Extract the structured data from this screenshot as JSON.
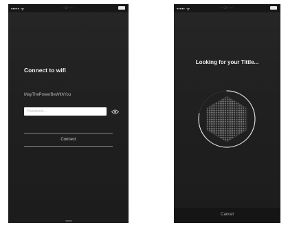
{
  "status_bar": {
    "carrier": "••••• ᯤ",
    "time": "··:·· ··"
  },
  "connect_screen": {
    "title": "Connect to wifi",
    "network_name": "MayThePowerBeWithYou",
    "password_placeholder": "Password...",
    "password_value": "",
    "connect_label": "Connect"
  },
  "search_screen": {
    "title": "Looking for your Tittle...",
    "progress": 0.78,
    "cancel_label": "Cancel"
  },
  "colors": {
    "background": "#222222",
    "text": "#f2f2f2",
    "input_bg": "#ffffff",
    "progress_ring": "#dcdcdc"
  },
  "icons": [
    "eye-icon",
    "battery-icon",
    "hexagon-device-icon"
  ]
}
